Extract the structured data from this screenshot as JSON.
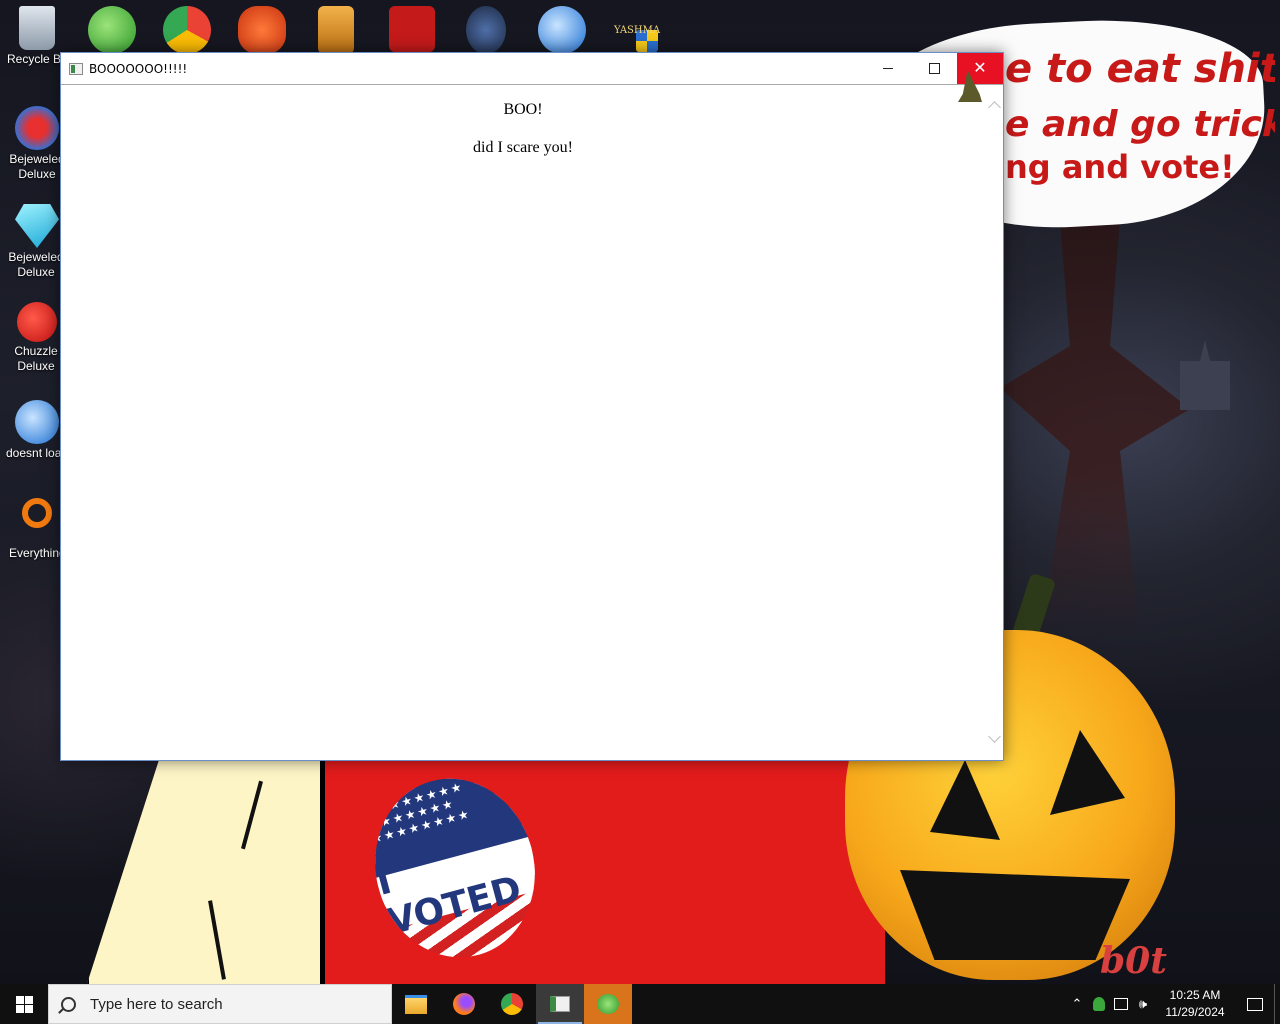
{
  "wallpaper": {
    "bubble_lines": [
      "e to eat shit",
      "e and go trick",
      "ng and vote!"
    ],
    "badge_text": "I VOTED",
    "watermark": "b0t"
  },
  "desktop_icons": [
    {
      "label": "Recycle Bin",
      "icon": "recycle-bin-icon"
    },
    {
      "label": "Bejeweled Deluxe",
      "icon": "bejeweled-2-icon"
    },
    {
      "label": "Bejeweled Deluxe",
      "icon": "bejeweled-gem-icon"
    },
    {
      "label": "Chuzzle Deluxe",
      "icon": "chuzzle-icon"
    },
    {
      "label": "doesnt load",
      "icon": "thunderbird-icon"
    },
    {
      "label": "Everything",
      "icon": "everything-search-icon"
    }
  ],
  "top_icons": [
    {
      "icon": "msn-messenger-icon"
    },
    {
      "icon": "chrome-icon"
    },
    {
      "icon": "p-app-icon"
    },
    {
      "icon": "folder-app-icon"
    },
    {
      "icon": "flash-icon"
    },
    {
      "icon": "game-shield-icon"
    },
    {
      "icon": "thunderbird-icon"
    },
    {
      "icon": "yashma-shield-icon",
      "label": "YASHMA"
    }
  ],
  "window": {
    "title": "BOOOOOOO!!!!!",
    "heading": "BOO!",
    "message": "did I scare you!",
    "buttons": {
      "minimize": "minimize-icon",
      "maximize": "maximize-icon",
      "close": "close-icon"
    }
  },
  "taskbar": {
    "search_placeholder": "Type here to search",
    "apps": [
      {
        "icon": "file-explorer-icon",
        "active": false
      },
      {
        "icon": "firefox-icon",
        "active": false
      },
      {
        "icon": "chrome-icon",
        "active": false
      },
      {
        "icon": "window-app-icon",
        "active": true
      },
      {
        "icon": "msn-messenger-icon",
        "active": false
      }
    ],
    "time": "10:25 AM",
    "date": "11/29/2024"
  },
  "colors": {
    "close_red": "#e81123",
    "taskbar": "#101010",
    "bubble_text": "#c81919"
  }
}
